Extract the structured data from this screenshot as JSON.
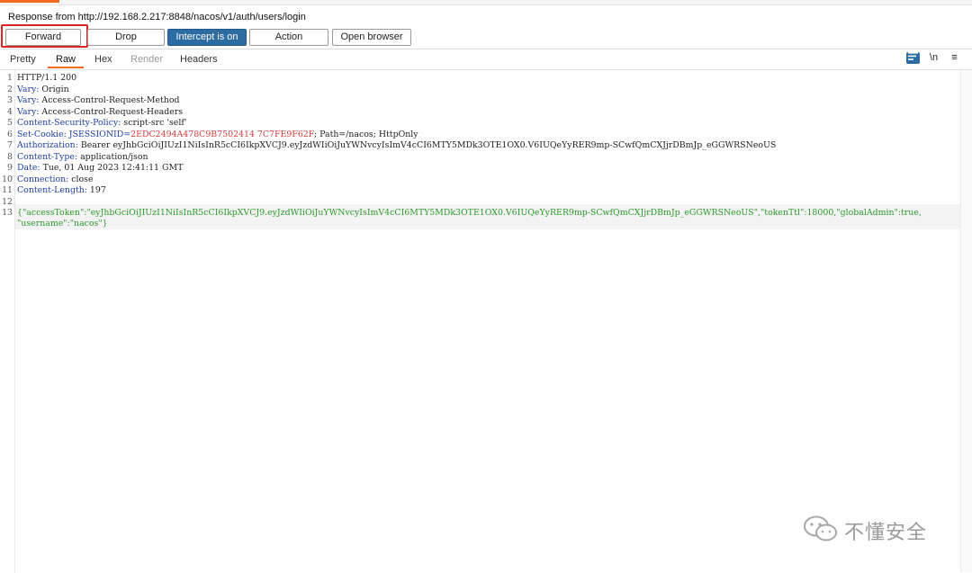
{
  "header": {
    "title": "Response from http://192.168.2.217:8848/nacos/v1/auth/users/login"
  },
  "buttons": {
    "forward": "Forward",
    "drop": "Drop",
    "intercept": "Intercept is on",
    "action": "Action",
    "open_browser": "Open browser"
  },
  "tabs": [
    "Pretty",
    "Raw",
    "Hex",
    "Render",
    "Headers"
  ],
  "toolbar_icons": [
    "wrap-icon",
    "newline-icon",
    "menu-icon"
  ],
  "toolbar_labels": {
    "newline": "\\n",
    "menu": "≡"
  },
  "response_lines": [
    {
      "n": "1",
      "key": "",
      "val": "HTTP/1.1 200"
    },
    {
      "n": "2",
      "key": "Vary",
      "val": " Origin"
    },
    {
      "n": "3",
      "key": "Vary",
      "val": " Access-Control-Request-Method"
    },
    {
      "n": "4",
      "key": "Vary",
      "val": " Access-Control-Request-Headers"
    },
    {
      "n": "5",
      "key": "Content-Security-Policy",
      "val": " script-src 'self'"
    },
    {
      "n": "6",
      "key": "Set-Cookie",
      "cookie_name": " JSESSIONID=",
      "cookie_val": "2EDC2494A478C9B7502414 7C7FE9F62F",
      "val": "; Path=/nacos; HttpOnly"
    },
    {
      "n": "7",
      "key": "Authorization",
      "val": " Bearer eyJhbGciOiJIUzI1NiIsInR5cCI6IkpXVCJ9.eyJzdWIiOiJuYWNvcyIsImV4cCI6MTY5MDk3OTE1OX0.V6IUQeYyRER9mp-SCwfQmCXJjrDBmJp_eGGWRSNeoUS"
    },
    {
      "n": "8",
      "key": "Content-Type",
      "val": " application/json"
    },
    {
      "n": "9",
      "key": "Date",
      "val": " Tue, 01 Aug 2023 12:41:11 GMT"
    },
    {
      "n": "10",
      "key": "Connection",
      "val": " close"
    },
    {
      "n": "11",
      "key": "Content-Length",
      "val": " 197"
    },
    {
      "n": "12",
      "key": "",
      "val": ""
    }
  ],
  "body_line": {
    "n": "13",
    "part1": "{\"accessToken\":\"eyJhbGciOiJIUzI1NiIsInR5cCI6IkpXVCJ9.eyJzdWIiOiJuYWNvcyIsImV4cCI6MTY5MDk3OTE1OX0.V6IUQeYyRER9mp-SCwfQmCXJjrDBmJp_eGGWRSNeoUS\",\"tokenTtl\":18000,\"globalAdmin\":true,",
    "part2": "\"username\":\"nacos\"}"
  },
  "watermark": "不懂安全"
}
